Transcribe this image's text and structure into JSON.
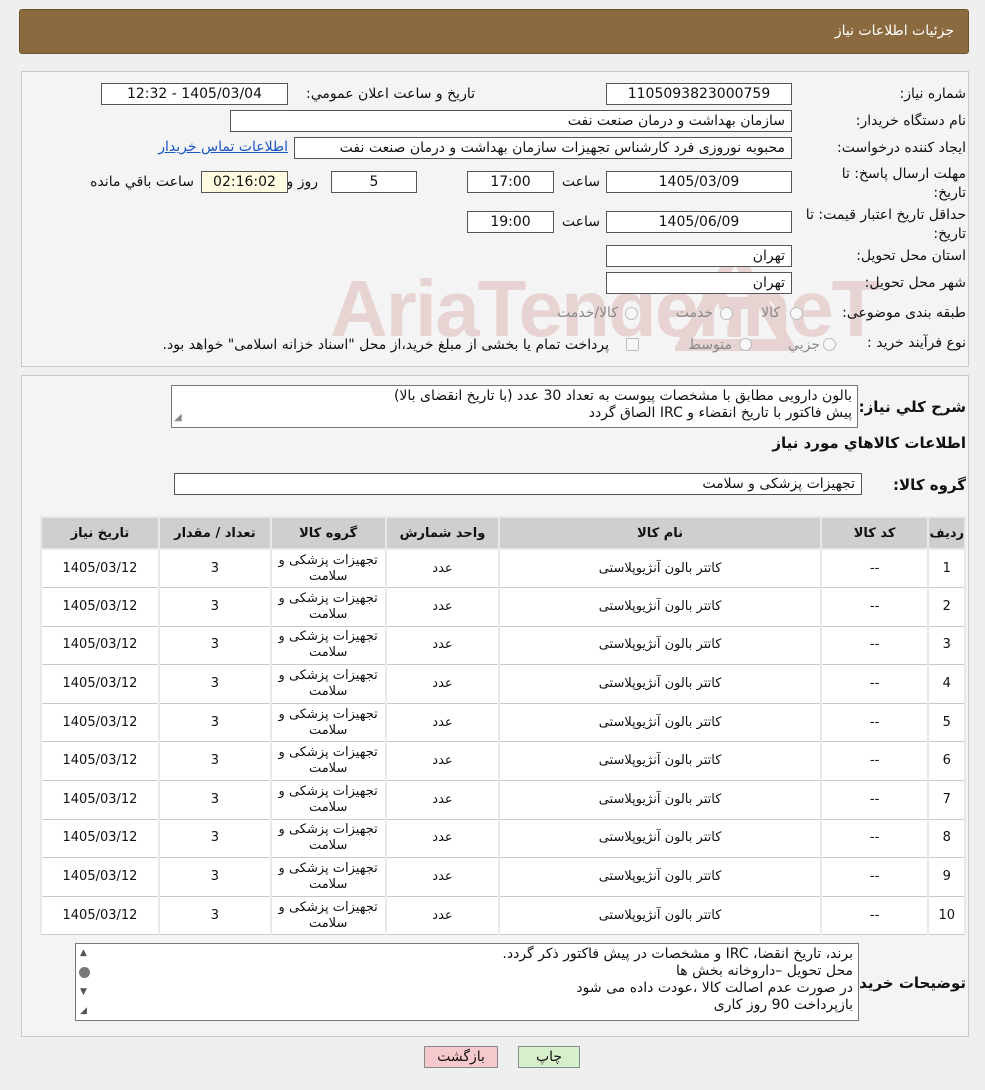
{
  "header": {
    "title": "جزئیات اطلاعات نیاز"
  },
  "watermark": {
    "text": "AriaTender.neT"
  },
  "form": {
    "need_number_label": "شماره نیاز:",
    "need_number": "1105093823000759",
    "announce_label": "تاريخ و ساعت اعلان عمومي:",
    "announce_value": "1405/03/04 - 12:32",
    "buyer_org_label": "نام دستگاه خريدار:",
    "buyer_org": "سازمان بهداشت و درمان صنعت نفت",
    "creator_label": "ايجاد كننده درخواست:",
    "creator": "محبوبه نوروزی فرد کارشناس تجهیزات سازمان بهداشت و درمان صنعت نفت",
    "contact_link": "اطلاعات تماس خريدار",
    "deadline_label": "مهلت ارسال پاسخ: تا تاريخ:",
    "deadline_date": "1405/03/09",
    "time_word": "ساعت",
    "deadline_time": "17:00",
    "days_value": "5",
    "days_word": "روز و",
    "remaining_time": "02:16:02",
    "remaining_label": "ساعت باقي مانده",
    "validity_label": "حداقل تاريخ اعتبار قيمت: تا تاريخ:",
    "validity_date": "1405/06/09",
    "validity_time": "19:00",
    "province_label": "استان محل تحويل:",
    "province": "تهران",
    "city_label": "شهر محل تحويل:",
    "city": "تهران",
    "category_label": "طبقه بندی موضوعی:",
    "category_options": [
      "كالا",
      "خدمت",
      "كالا/خدمت"
    ],
    "process_label": "نوع فرآيند خريد :",
    "process_options": [
      "جزيي",
      "متوسط"
    ],
    "process_note": "پرداخت تمام يا بخشی از مبلغ خريد،از محل \"اسناد خزانه اسلامی\" خواهد بود."
  },
  "description": {
    "label": "شرح كلي نياز:",
    "line1": "بالون دارویی مطابق با مشخصات پیوست به تعداد 30 عدد (با تاریخ انقضای بالا)",
    "line2": "پیش فاکتور با تاریخ انقضاء و IRC الصاق گردد"
  },
  "goods_info_title": "اطلاعات كالاهاي مورد نياز",
  "goods_group": {
    "label": "گروه كالا:",
    "value": "تجهیزات پزشکی و سلامت"
  },
  "table": {
    "headers": [
      "رديف",
      "كد كالا",
      "نام كالا",
      "واحد شمارش",
      "گروه كالا",
      "تعداد / مقدار",
      "تاريخ نياز"
    ],
    "rows": [
      [
        "1",
        "--",
        "کاتتر بالون آنژیوپلاستی",
        "عدد",
        "تجهیزات پزشکی و سلامت",
        "3",
        "1405/03/12"
      ],
      [
        "2",
        "--",
        "کاتتر بالون آنژیوپلاستی",
        "عدد",
        "تجهیزات پزشکی و سلامت",
        "3",
        "1405/03/12"
      ],
      [
        "3",
        "--",
        "کاتتر بالون آنژیوپلاستی",
        "عدد",
        "تجهیزات پزشکی و سلامت",
        "3",
        "1405/03/12"
      ],
      [
        "4",
        "--",
        "کاتتر بالون آنژیوپلاستی",
        "عدد",
        "تجهیزات پزشکی و سلامت",
        "3",
        "1405/03/12"
      ],
      [
        "5",
        "--",
        "کاتتر بالون آنژیوپلاستی",
        "عدد",
        "تجهیزات پزشکی و سلامت",
        "3",
        "1405/03/12"
      ],
      [
        "6",
        "--",
        "کاتتر بالون آنژیوپلاستی",
        "عدد",
        "تجهیزات پزشکی و سلامت",
        "3",
        "1405/03/12"
      ],
      [
        "7",
        "--",
        "کاتتر بالون آنژیوپلاستی",
        "عدد",
        "تجهیزات پزشکی و سلامت",
        "3",
        "1405/03/12"
      ],
      [
        "8",
        "--",
        "کاتتر بالون آنژیوپلاستی",
        "عدد",
        "تجهیزات پزشکی و سلامت",
        "3",
        "1405/03/12"
      ],
      [
        "9",
        "--",
        "کاتتر بالون آنژیوپلاستی",
        "عدد",
        "تجهیزات پزشکی و سلامت",
        "3",
        "1405/03/12"
      ],
      [
        "10",
        "--",
        "کاتتر بالون آنژیوپلاستی",
        "عدد",
        "تجهیزات پزشکی و سلامت",
        "3",
        "1405/03/12"
      ]
    ]
  },
  "buyer_notes": {
    "label": "توضيحات خريدار:",
    "lines": [
      "برند،  تاریخ انقضا، IRC و مشخصات در پیش فاکتور ذکر گردد.",
      "محل تحویل –داروخانه بخش ها",
      "در صورت عدم اصالت کالا ،عودت داده می شود",
      "بازپرداخت 90 روز کاری"
    ]
  },
  "buttons": {
    "back": "بازگشت",
    "print": "چاپ"
  }
}
